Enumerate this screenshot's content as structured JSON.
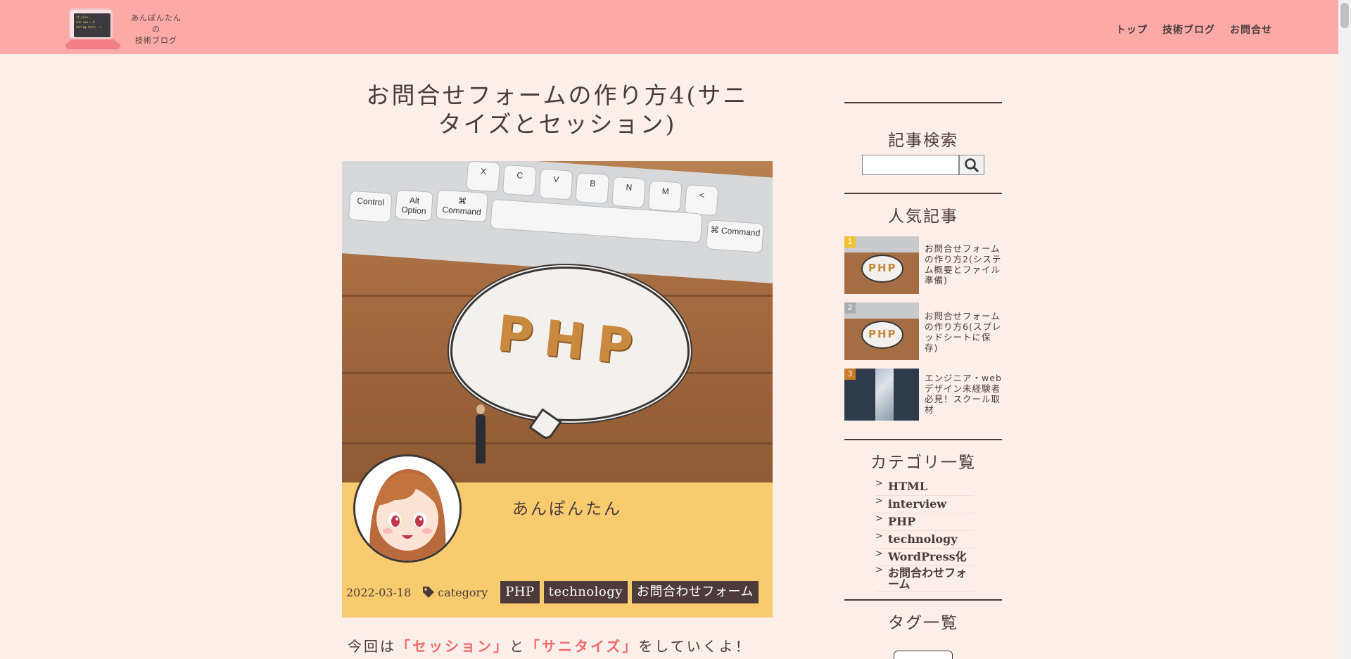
{
  "header": {
    "logo_code": [
      "if_else...",
      "int sum = 0",
      "string text; ->"
    ],
    "site_title_lines": [
      "あんぽんたん",
      "の",
      "技術ブログ"
    ],
    "nav": [
      "トップ",
      "技術ブログ",
      "お問合せ"
    ]
  },
  "article": {
    "title": "お問合せフォームの作り方4(サニタイズとセッション)",
    "hero_keys": [
      "Control",
      "Alt Option",
      "⌘ Command",
      "X",
      "C",
      "V",
      "B",
      "N",
      "M",
      "<",
      "⌘ Command"
    ],
    "hero_text": "PHP",
    "author_name": "あんぽんたん",
    "date": "2022-03-18",
    "category_label": "category",
    "categories": [
      "PHP",
      "technology",
      "お問合わせフォーム"
    ],
    "intro": {
      "prefix": "今回は",
      "hl1": "「セッション」",
      "mid": "と",
      "hl2": "「サニタイズ」",
      "suffix": "をしていくよ！"
    }
  },
  "sidebar": {
    "search_heading": "記事検索",
    "search_placeholder": "",
    "popular_heading": "人気記事",
    "popular": [
      {
        "rank": "1",
        "title": "お問合せフォームの作り方2(システム概要とファイル準備)",
        "thumb_text": "PHP",
        "rank_color": "#f2c230"
      },
      {
        "rank": "2",
        "title": "お問合せフォームの作り方6(スプレッドシートに保存)",
        "thumb_text": "PHP",
        "rank_color": "#a7acb0"
      },
      {
        "rank": "3",
        "title": "エンジニア・webデザイン未経験者必見！スクール取材",
        "thumb_text": "",
        "rank_color": "#c97a2a"
      }
    ],
    "category_heading": "カテゴリ一覧",
    "categories": [
      "HTML",
      "interview",
      "PHP",
      "technology",
      "WordPress化",
      "お問合わせフォーム"
    ],
    "tag_heading": "タグ一覧"
  },
  "colors": {
    "header_bg": "#fcaaa8",
    "page_bg": "#fceee8",
    "author_bg": "#f8cb6e",
    "badge_bg": "#4d3b3c",
    "highlight": "#f36b6b"
  }
}
